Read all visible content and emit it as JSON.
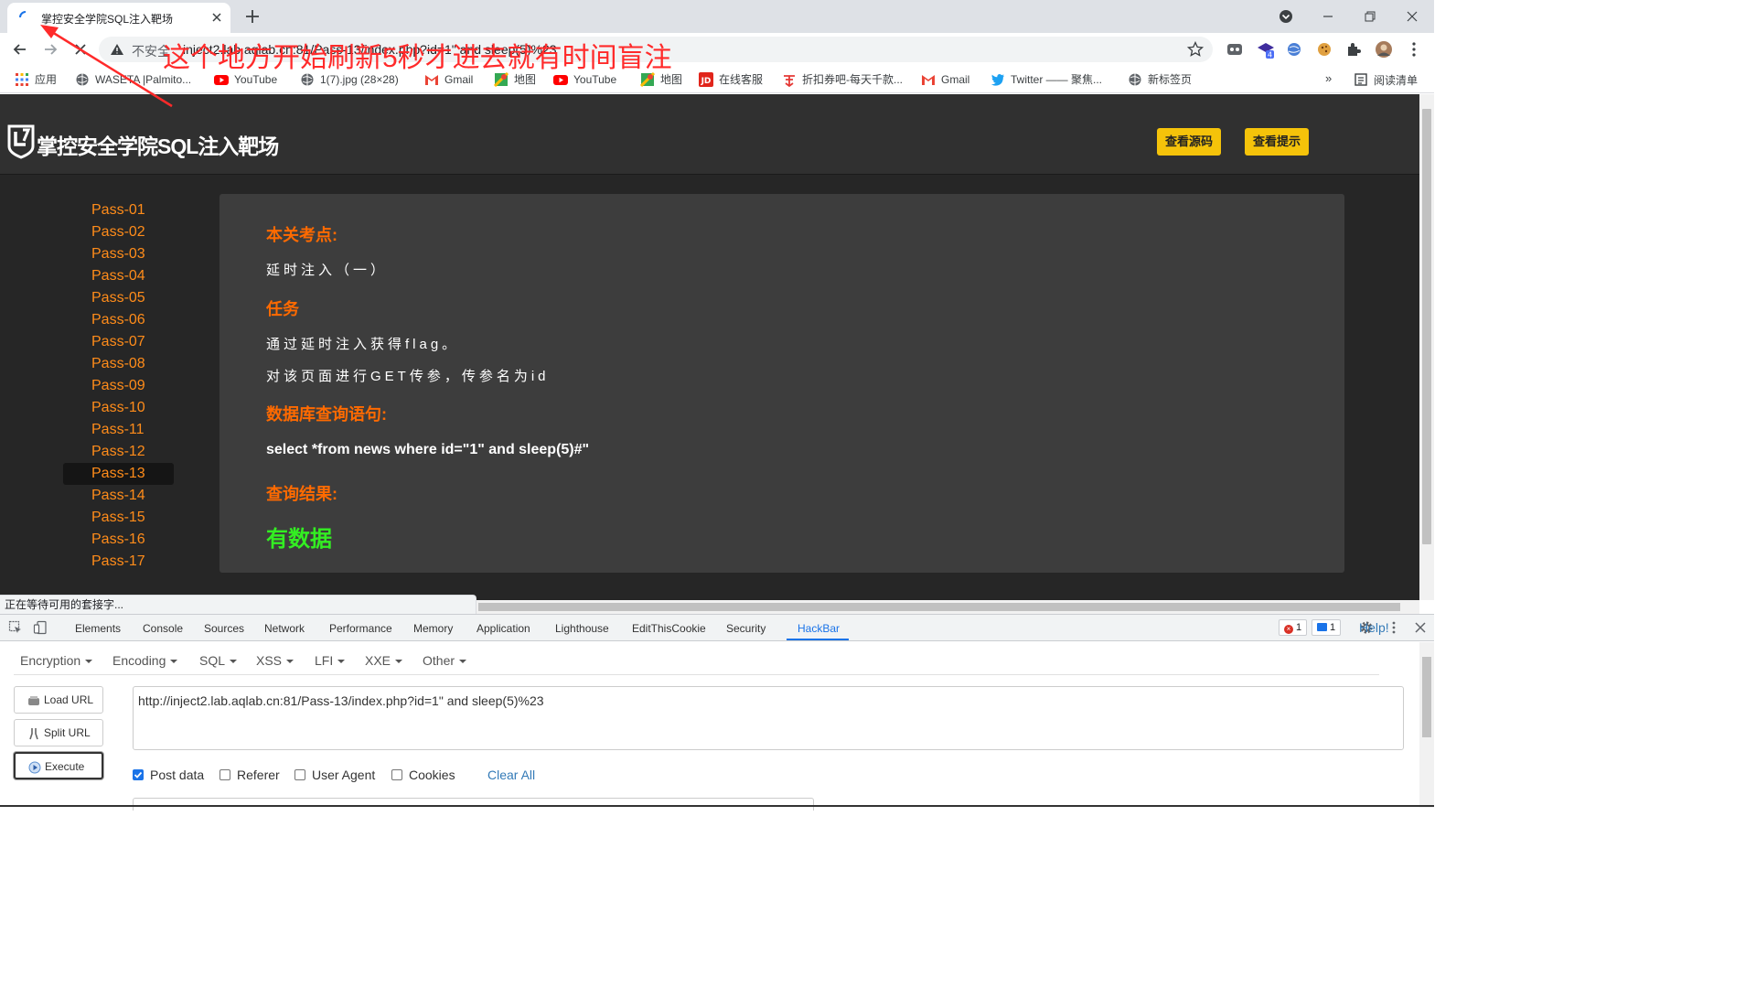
{
  "tab": {
    "title": "掌控安全学院SQL注入靶场"
  },
  "address_bar": {
    "security_label": "不安全",
    "url": "inject2.lab.aqlab.cn:81/Pass-13/index.php?id=1\" and sleep(5)%23"
  },
  "annotation": "这个地方开始刷新5秒才进去就有时间盲注",
  "bookmarks": [
    {
      "label": "应用",
      "icon": "apps-grid-icon"
    },
    {
      "label": "WASETA |Palmito...",
      "icon": "globe-icon"
    },
    {
      "label": "YouTube",
      "icon": "youtube-icon"
    },
    {
      "label": "1(7).jpg (28×28)",
      "icon": "globe-icon"
    },
    {
      "label": "Gmail",
      "icon": "gmail-icon"
    },
    {
      "label": "地图",
      "icon": "maps-icon"
    },
    {
      "label": "YouTube",
      "icon": "youtube-icon"
    },
    {
      "label": "地图",
      "icon": "maps-icon"
    },
    {
      "label": "在线客服",
      "icon": "jd-icon"
    },
    {
      "label": "折扣券吧-每天千款...",
      "icon": "coupon-icon"
    },
    {
      "label": "Gmail",
      "icon": "gmail-icon"
    },
    {
      "label": "Twitter —— 聚焦...",
      "icon": "twitter-icon"
    },
    {
      "label": "新标签页",
      "icon": "globe-icon"
    }
  ],
  "bookmarks_overflow": "»",
  "reading_list": "阅读清单",
  "site": {
    "title": "掌控安全学院SQL注入靶场",
    "buttons": [
      "查看源码",
      "查看提示"
    ],
    "nav": [
      "Pass-01",
      "Pass-02",
      "Pass-03",
      "Pass-04",
      "Pass-05",
      "Pass-06",
      "Pass-07",
      "Pass-08",
      "Pass-09",
      "Pass-10",
      "Pass-11",
      "Pass-12",
      "Pass-13",
      "Pass-14",
      "Pass-15",
      "Pass-16",
      "Pass-17"
    ],
    "active_nav": "Pass-13",
    "content": {
      "topic_heading": "本关考点:",
      "topic_text": "延时注入（一）",
      "task_heading": "任务",
      "task_lines": [
        "通过延时注入获得flag。",
        "对该页面进行GET传参，传参名为id"
      ],
      "query_heading": "数据库查询语句:",
      "query": "select *from news where id=\"1\" and sleep(5)#\"",
      "result_heading": "查询结果:",
      "result": "有数据"
    }
  },
  "status_bar": "正在等待可用的套接字...",
  "devtools": {
    "tabs": [
      "Elements",
      "Console",
      "Sources",
      "Network",
      "Performance",
      "Memory",
      "Application",
      "Lighthouse",
      "EditThisCookie",
      "Security",
      "HackBar"
    ],
    "active_tab": "HackBar",
    "error_count": "1",
    "message_count": "1"
  },
  "hackbar": {
    "menus": [
      "Encryption",
      "Encoding",
      "SQL",
      "XSS",
      "LFI",
      "XXE",
      "Other"
    ],
    "help": "Help!",
    "buttons": [
      "Load URL",
      "Split URL",
      "Execute"
    ],
    "url": "http://inject2.lab.aqlab.cn:81/Pass-13/index.php?id=1\" and sleep(5)%23",
    "options": [
      {
        "label": "Post data",
        "checked": true
      },
      {
        "label": "Referer",
        "checked": false
      },
      {
        "label": "User Agent",
        "checked": false
      },
      {
        "label": "Cookies",
        "checked": false
      }
    ],
    "clear_all": "Clear All"
  },
  "colors": {
    "accent": "#ff8c1a",
    "heading": "#ff6a00",
    "result": "#33ee22",
    "button": "#f5c30a",
    "annotation": "#ff2a2a"
  }
}
